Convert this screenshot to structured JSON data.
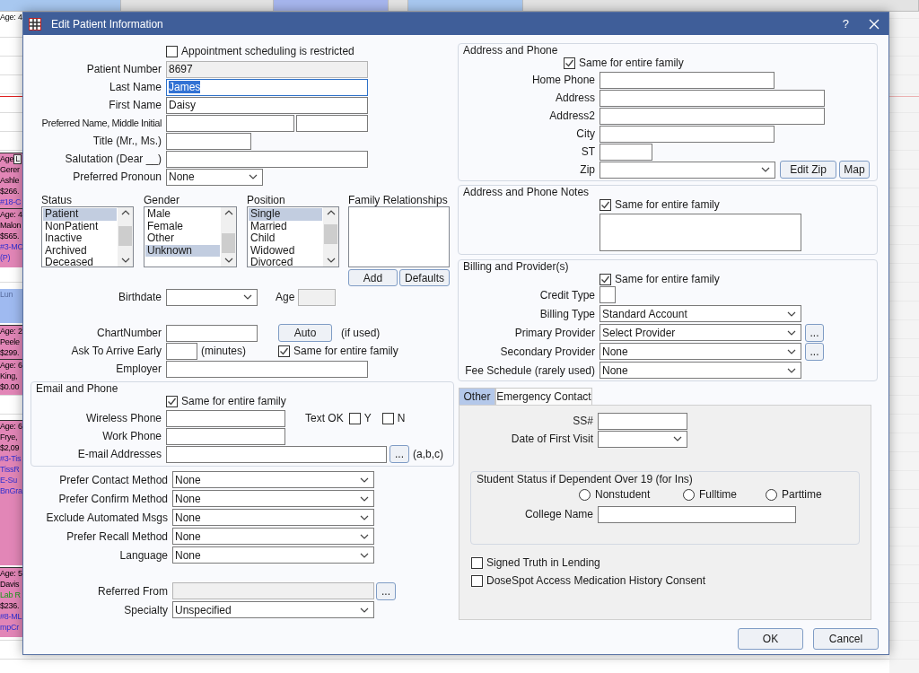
{
  "calendar": {
    "blocks": [
      {
        "kind": "plain",
        "lines": [
          {
            "text": "Age: 4",
            "kind": "info"
          }
        ]
      },
      {
        "kind": "appointment",
        "tag": "L",
        "lines": [
          {
            "text": "Age",
            "kind": "info"
          },
          {
            "text": "Gerer",
            "kind": "info"
          },
          {
            "text": "Ashle",
            "kind": "info"
          },
          {
            "text": "$266.",
            "kind": "info"
          },
          {
            "text": "#18-C",
            "kind": "procedure"
          }
        ]
      },
      {
        "kind": "appointment",
        "lines": [
          {
            "text": "Age: 4",
            "kind": "info"
          },
          {
            "text": "Malon",
            "kind": "info"
          },
          {
            "text": "$565.",
            "kind": "info"
          },
          {
            "text": "#3-MC",
            "kind": "procedure"
          },
          {
            "text": "(P)",
            "kind": "procedure"
          }
        ]
      },
      {
        "kind": "break",
        "lines": [
          {
            "text": "Lun",
            "kind": "break"
          }
        ]
      },
      {
        "kind": "appointment",
        "lines": [
          {
            "text": "Age: 2",
            "kind": "info"
          },
          {
            "text": "Peele",
            "kind": "info"
          },
          {
            "text": "$299.",
            "kind": "info"
          }
        ]
      },
      {
        "kind": "appointment",
        "lines": [
          {
            "text": "Age: 6",
            "kind": "info"
          },
          {
            "text": "King,",
            "kind": "info"
          },
          {
            "text": "$0.00",
            "kind": "info"
          }
        ]
      },
      {
        "kind": "appointment",
        "lines": [
          {
            "text": "Age: 6",
            "kind": "info"
          },
          {
            "text": "Frye,",
            "kind": "info"
          },
          {
            "text": "$2,09",
            "kind": "info"
          },
          {
            "text": "#3-Tis",
            "kind": "procedure"
          },
          {
            "text": "TissR",
            "kind": "procedure"
          },
          {
            "text": "E-Su",
            "kind": "procedure"
          },
          {
            "text": "BnGra",
            "kind": "procedure"
          }
        ]
      },
      {
        "kind": "appointment",
        "lines": [
          {
            "text": "Age: 5",
            "kind": "info"
          },
          {
            "text": "Davis",
            "kind": "info"
          },
          {
            "text": "Lab R",
            "kind": "lab"
          },
          {
            "text": "$236.",
            "kind": "info"
          },
          {
            "text": "#8-ML",
            "kind": "procedure"
          },
          {
            "text": "mpCr",
            "kind": "procedure"
          }
        ]
      }
    ]
  },
  "window": {
    "title": "Edit Patient Information",
    "help": "?"
  },
  "appointment_restricted": {
    "label": "Appointment scheduling is restricted",
    "checked": false
  },
  "patient_fields": [
    {
      "label": "Patient Number",
      "value": "8697",
      "kind": "readonly",
      "focused": false
    },
    {
      "label": "Last Name",
      "value": "James",
      "kind": "text",
      "focused": true
    },
    {
      "label": "First Name",
      "value": "Daisy",
      "kind": "text",
      "focused": false
    },
    {
      "label": "Preferred Name, Middle Initial",
      "kind": "pair",
      "focused": false
    },
    {
      "label": "Title (Mr., Ms.)",
      "kind": "short",
      "focused": false
    },
    {
      "label": "Salutation (Dear __)",
      "kind": "text",
      "focused": false
    },
    {
      "label": "Preferred Pronoun",
      "value": "None",
      "kind": "select",
      "focused": false
    }
  ],
  "lists": [
    {
      "label": "Status",
      "items": [
        {
          "text": "Patient",
          "selected": true
        },
        {
          "text": "NonPatient",
          "selected": false
        },
        {
          "text": "Inactive",
          "selected": false
        },
        {
          "text": "Archived",
          "selected": false
        },
        {
          "text": "Deceased",
          "selected": false
        }
      ]
    },
    {
      "label": "Gender",
      "items": [
        {
          "text": "Male",
          "selected": false
        },
        {
          "text": "Female",
          "selected": false
        },
        {
          "text": "Other",
          "selected": false
        },
        {
          "text": "Unknown",
          "selected": true
        }
      ]
    },
    {
      "label": "Position",
      "items": [
        {
          "text": "Single",
          "selected": true
        },
        {
          "text": "Married",
          "selected": false
        },
        {
          "text": "Child",
          "selected": false
        },
        {
          "text": "Widowed",
          "selected": false
        },
        {
          "text": "Divorced",
          "selected": false
        }
      ]
    }
  ],
  "family_relationships": {
    "label": "Family Relationships",
    "buttons": [
      "Add",
      "Defaults"
    ]
  },
  "birthdate": {
    "label": "Birthdate"
  },
  "age": {
    "label": "Age"
  },
  "chart_number": {
    "label": "ChartNumber",
    "button": "Auto",
    "note": "(if used)"
  },
  "arrive_early": {
    "label": "Ask To Arrive Early",
    "unit": "(minutes)",
    "same_for_family": {
      "label": "Same for entire family",
      "checked": true
    }
  },
  "employer": {
    "label": "Employer"
  },
  "email_phone": {
    "title": "Email and Phone",
    "same_for_family": {
      "label": "Same for entire family",
      "checked": true
    },
    "wireless_phone": {
      "label": "Wireless Phone"
    },
    "text_ok": {
      "label": "Text OK",
      "options": [
        {
          "label": "Y",
          "checked": false
        },
        {
          "label": "N",
          "checked": false
        }
      ]
    },
    "work_phone": {
      "label": "Work Phone"
    },
    "email": {
      "label": "E-mail Addresses",
      "button": "...",
      "note": "(a,b,c)"
    }
  },
  "preferences": [
    {
      "label": "Prefer Contact Method",
      "value": "None"
    },
    {
      "label": "Prefer Confirm Method",
      "value": "None"
    },
    {
      "label": "Exclude Automated Msgs",
      "value": "None"
    },
    {
      "label": "Prefer Recall Method",
      "value": "None"
    },
    {
      "label": "Language",
      "value": "None"
    }
  ],
  "referred_from": {
    "label": "Referred From",
    "button": "..."
  },
  "specialty": {
    "label": "Specialty",
    "value": "Unspecified"
  },
  "address_phone": {
    "title": "Address and Phone",
    "same_for_family": {
      "label": "Same for entire family",
      "checked": true
    },
    "fields": [
      {
        "label": "Home Phone",
        "kind": "medium"
      },
      {
        "label": "Address",
        "kind": "long"
      },
      {
        "label": "Address2",
        "kind": "long"
      },
      {
        "label": "City",
        "kind": "medium"
      },
      {
        "label": "ST",
        "kind": "short"
      },
      {
        "label": "Zip",
        "kind": "zip"
      }
    ],
    "buttons": [
      "Edit Zip",
      "Map"
    ]
  },
  "address_notes": {
    "title": "Address and Phone Notes",
    "same_for_family": {
      "label": "Same for entire family",
      "checked": true
    }
  },
  "billing": {
    "title": "Billing and Provider(s)",
    "same_for_family": {
      "label": "Same for entire family",
      "checked": true
    },
    "fields": [
      {
        "label": "Credit Type",
        "kind": "tiny"
      },
      {
        "label": "Billing Type",
        "kind": "select",
        "value": "Standard Account"
      },
      {
        "label": "Primary Provider",
        "kind": "select_button",
        "value": "Select Provider",
        "button": "..."
      },
      {
        "label": "Secondary Provider",
        "kind": "select_button",
        "value": "None",
        "button": "..."
      },
      {
        "label": "Fee Schedule (rarely used)",
        "kind": "select",
        "value": "None"
      }
    ]
  },
  "tabs": [
    {
      "label": "Other",
      "selected": true
    },
    {
      "label": "Emergency Contact",
      "selected": false
    }
  ],
  "other": {
    "ssn": {
      "label": "SS#"
    },
    "first_visit": {
      "label": "Date of First Visit"
    },
    "student_status": {
      "title": "Student Status if Dependent Over 19 (for Ins)",
      "options": [
        {
          "label": "Nonstudent",
          "selected": false
        },
        {
          "label": "Fulltime",
          "selected": false
        },
        {
          "label": "Parttime",
          "selected": false
        }
      ],
      "college_name": {
        "label": "College Name"
      }
    },
    "checks": [
      {
        "label": "Signed Truth in Lending",
        "checked": false
      },
      {
        "label": "DoseSpot Access Medication History Consent",
        "checked": false
      }
    ]
  },
  "buttons": [
    "OK",
    "Cancel"
  ]
}
